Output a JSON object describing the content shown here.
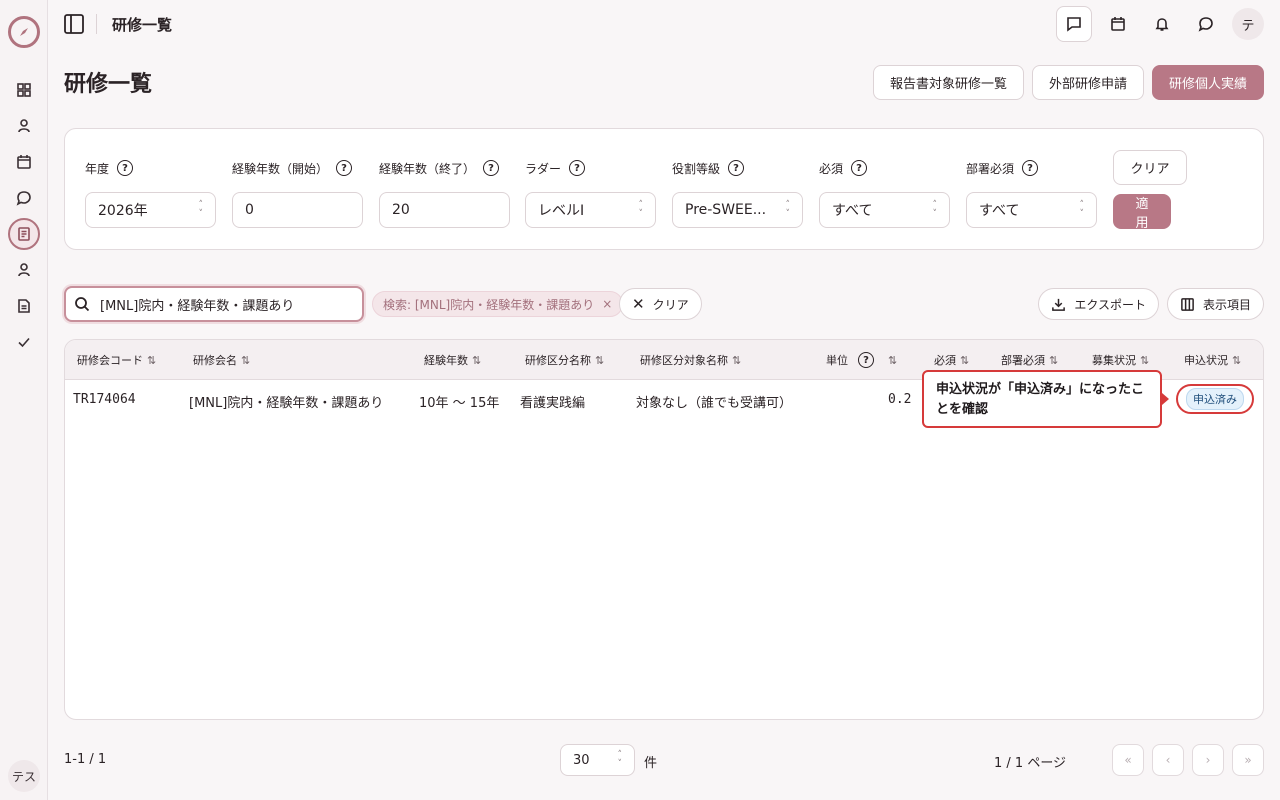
{
  "rail": {
    "items": [
      "dashboard-icon",
      "person-icon",
      "calendar-icon",
      "chat-icon",
      "document-icon",
      "person-icon",
      "file-icon",
      "check-icon"
    ],
    "user_initial": "テス"
  },
  "topbar": {
    "title": "研修一覧",
    "avatar": "テ"
  },
  "page": {
    "title": "研修一覧",
    "buttons": [
      "報告書対象研修一覧",
      "外部研修申請",
      "研修個人実績"
    ]
  },
  "filters": {
    "items": [
      {
        "label": "年度",
        "value": "2026年",
        "type": "select"
      },
      {
        "label": "経験年数（開始）",
        "value": "0",
        "type": "input"
      },
      {
        "label": "経験年数（終了）",
        "value": "20",
        "type": "input"
      },
      {
        "label": "ラダー",
        "value": "レベルI",
        "type": "select"
      },
      {
        "label": "役割等級",
        "value": "Pre-SWEE...",
        "type": "select"
      },
      {
        "label": "必須",
        "value": "すべて",
        "type": "select"
      },
      {
        "label": "部署必須",
        "value": "すべて",
        "type": "select"
      }
    ],
    "clear_label": "クリア",
    "apply_label": "適用"
  },
  "search": {
    "value": "[MNL]院内・経験年数・課題あり",
    "chip": "検索: [MNL]院内・経験年数・課題あり",
    "clear_label": "クリア",
    "export_label": "エクスポート",
    "columns_label": "表示項目"
  },
  "table": {
    "headers": [
      "研修会コード",
      "研修会名",
      "経験年数",
      "研修区分名称",
      "研修区分対象名称",
      "単位",
      "必須",
      "部署必須",
      "募集状況",
      "申込状況"
    ],
    "rows": [
      {
        "code": "TR174064",
        "name": "[MNL]院内・経験年数・課題あり",
        "years": "10年 〜 15年",
        "category": "看護実践編",
        "target": "対象なし（誰でも受講可）",
        "unit": "0.2",
        "status": "申込済み"
      }
    ]
  },
  "callout": {
    "text": "申込状況が「申込済み」になったことを確認"
  },
  "footer": {
    "range": "1-1 / 1",
    "page_size": "30",
    "unit": "件",
    "page": "1 / 1 ページ"
  },
  "colors": {
    "accent": "#b87886",
    "highlight": "#d63a3a",
    "badge_bg": "#e4f1fb"
  }
}
